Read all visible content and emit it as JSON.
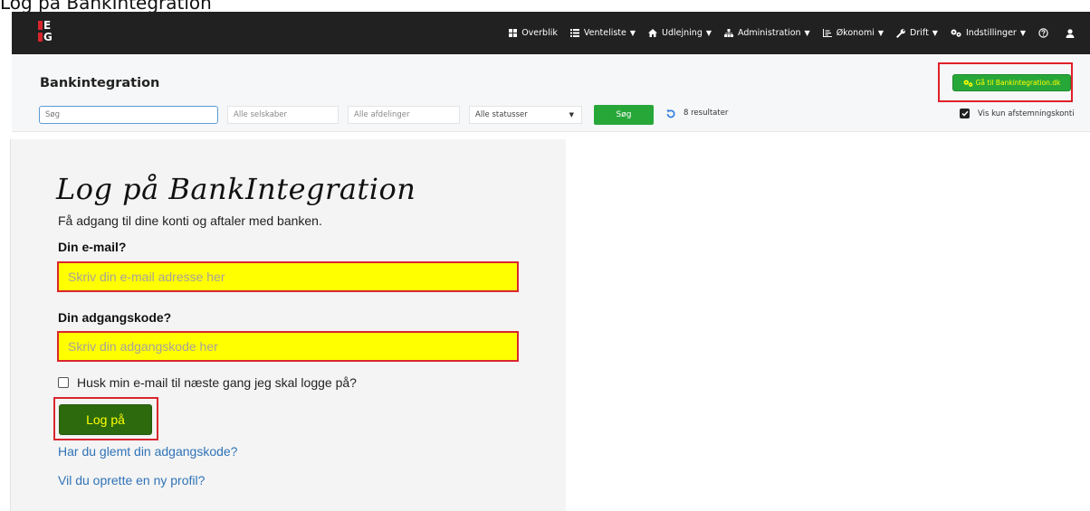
{
  "caption": "Log på BankIntegration",
  "navbar": {
    "logo_letters": [
      "E",
      "G"
    ],
    "items": [
      {
        "label": "Overblik",
        "icon": "windows-icon",
        "caret": false
      },
      {
        "label": "Venteliste",
        "icon": "list-icon",
        "caret": true
      },
      {
        "label": "Udlejning",
        "icon": "home-icon",
        "caret": true
      },
      {
        "label": "Administration",
        "icon": "sitemap-icon",
        "caret": true
      },
      {
        "label": "Økonomi",
        "icon": "chart-icon",
        "caret": true
      },
      {
        "label": "Drift",
        "icon": "wrench-icon",
        "caret": true
      },
      {
        "label": "Indstillinger",
        "icon": "cogs-icon",
        "caret": true
      }
    ],
    "help_icon": "question-circle-icon",
    "user_icon": "user-icon",
    "caret_glyph": "▼"
  },
  "subheader": {
    "title": "Bankintegration",
    "goto_button": "Gå til Bankintegration.dk",
    "search_value": "Søg",
    "company_filter": "Alle selskaber",
    "department_filter": "Alle afdelinger",
    "status_filter": "Alle statusser",
    "search_button": "Søg",
    "results": "8 resultater",
    "reconcile_only_label": "Vis kun afstemningskonti",
    "reconcile_only_checked": true
  },
  "login": {
    "title": "Log på BankIntegration",
    "subtitle": "Få adgang til dine konti og aftaler med banken.",
    "email_label": "Din e-mail?",
    "email_placeholder": "Skriv din e-mail adresse her",
    "password_label": "Din adgangskode?",
    "password_placeholder": "Skriv din adgangskode her",
    "remember_label": "Husk min e-mail til næste gang jeg skal logge på?",
    "remember_checked": false,
    "login_button": "Log på",
    "forgot_link": "Har du glemt din adgangskode?",
    "register_link": "Vil du oprette en ny profil?"
  },
  "colors": {
    "navbar_bg": "#212121",
    "accent_green": "#28a739",
    "login_button_green": "#2d6a0e",
    "highlight_yellow": "#ffff00",
    "annotation_red": "#d9262e",
    "link_blue": "#2f73b7"
  }
}
